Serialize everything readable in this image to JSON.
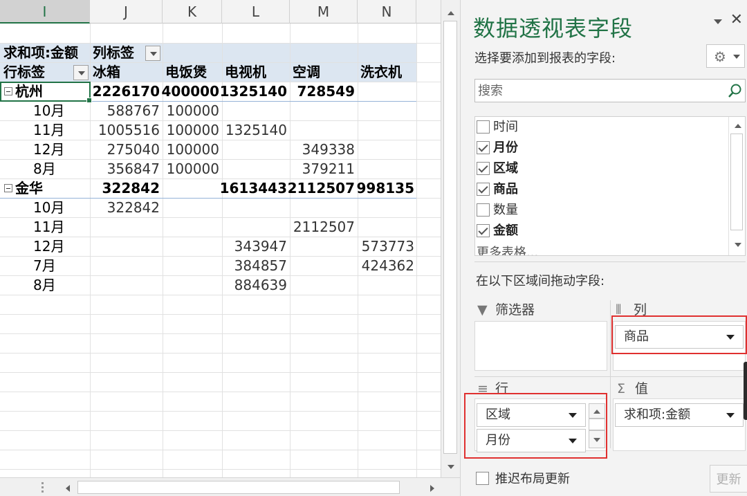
{
  "sheet": {
    "columns": [
      "I",
      "J",
      "K",
      "L",
      "M",
      "N"
    ],
    "selected_column": "I",
    "pivot": {
      "value_label": "求和项:金额",
      "col_labels_caption": "列标签",
      "row_labels_caption": "行标签",
      "products": [
        "冰箱",
        "电饭煲",
        "电视机",
        "空调",
        "洗衣机"
      ],
      "rows": [
        {
          "label": "杭州",
          "level": 0,
          "values": [
            "2226170",
            "400000",
            "1325140",
            "728549",
            ""
          ]
        },
        {
          "label": "10月",
          "level": 1,
          "values": [
            "588767",
            "100000",
            "",
            "",
            ""
          ]
        },
        {
          "label": "11月",
          "level": 1,
          "values": [
            "1005516",
            "100000",
            "1325140",
            "",
            ""
          ]
        },
        {
          "label": "12月",
          "level": 1,
          "values": [
            "275040",
            "100000",
            "",
            "349338",
            ""
          ]
        },
        {
          "label": "8月",
          "level": 1,
          "values": [
            "356847",
            "100000",
            "",
            "379211",
            ""
          ]
        },
        {
          "label": "金华",
          "level": 0,
          "values": [
            "322842",
            "",
            "1613443",
            "2112507",
            "998135"
          ]
        },
        {
          "label": "10月",
          "level": 1,
          "values": [
            "322842",
            "",
            "",
            "",
            ""
          ]
        },
        {
          "label": "11月",
          "level": 1,
          "values": [
            "",
            "",
            "",
            "2112507",
            ""
          ]
        },
        {
          "label": "12月",
          "level": 1,
          "values": [
            "",
            "",
            "343947",
            "",
            "573773"
          ]
        },
        {
          "label": "7月",
          "level": 1,
          "values": [
            "",
            "",
            "384857",
            "",
            "424362"
          ]
        },
        {
          "label": "8月",
          "level": 1,
          "values": [
            "",
            "",
            "884639",
            "",
            ""
          ]
        }
      ]
    }
  },
  "pane": {
    "title": "数据透视表字段",
    "close_glyph": "✕",
    "gear_glyph": "⚙",
    "choose_label": "选择要添加到报表的字段:",
    "search_placeholder": "搜索",
    "fields": [
      {
        "label": "时间",
        "checked": false
      },
      {
        "label": "月份",
        "checked": true
      },
      {
        "label": "区域",
        "checked": true
      },
      {
        "label": "商品",
        "checked": true
      },
      {
        "label": "数量",
        "checked": false
      },
      {
        "label": "金额",
        "checked": true
      }
    ],
    "more_tables": "更多表格...",
    "drag_label": "在以下区域间拖动字段:",
    "areas": {
      "filters": {
        "title": "筛选器",
        "icon": "▼"
      },
      "columns": {
        "title": "列",
        "icon": "⦀",
        "items": [
          "商品"
        ]
      },
      "rows": {
        "title": "行",
        "icon": "≡",
        "items": [
          "区域",
          "月份"
        ]
      },
      "values": {
        "title": "值",
        "icon": "Σ",
        "items": [
          "求和项:金额"
        ]
      }
    },
    "defer_label": "推迟布局更新",
    "update_button": "更新"
  },
  "colors": {
    "accent": "#217346",
    "pivot_header_bg": "#dce6f1",
    "highlight": "#e0302f"
  }
}
